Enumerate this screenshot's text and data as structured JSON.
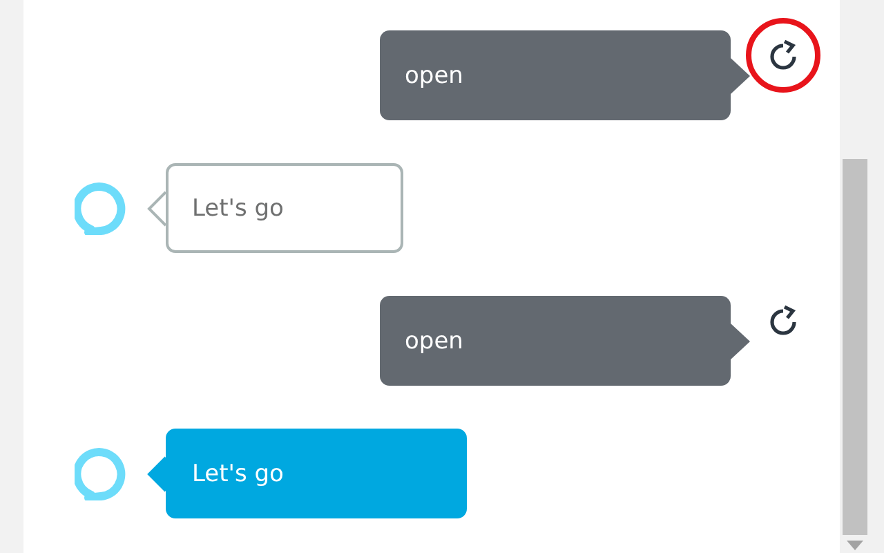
{
  "messages": [
    {
      "kind": "user",
      "text": "open",
      "circled": true
    },
    {
      "kind": "assistant",
      "text": "Let's go",
      "active": false
    },
    {
      "kind": "user",
      "text": "open",
      "circled": false
    },
    {
      "kind": "assistant",
      "text": "Let's go",
      "active": true
    }
  ]
}
